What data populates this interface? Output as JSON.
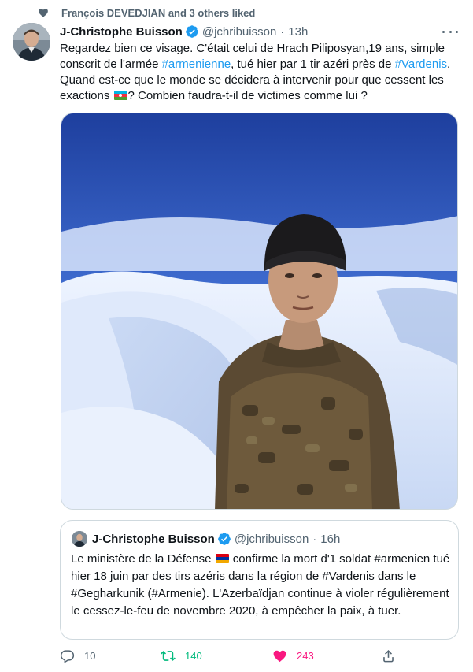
{
  "social_context": {
    "text": "François DEVEDJIAN and 3 others liked"
  },
  "tweet": {
    "author_name": "J-Christophe Buisson",
    "handle": "@jchribuisson",
    "separator": "·",
    "time": "13h",
    "text": {
      "part1": "Regardez bien ce visage. C'était celui de Hrach Piliposyan,19 ans, simple conscrit de l'armée ",
      "hashtag1": "#armenienne",
      "part2": ", tué hier par 1 tir azéri près de ",
      "hashtag2": "#Vardenis",
      "part3": ". Quand est-ce que le monde se décidera à intervenir pour que cessent les exactions ",
      "part4": "? Combien faudra-t-il de victimes comme lui ?"
    }
  },
  "quoted_tweet": {
    "author_name": "J-Christophe Buisson",
    "handle": "@jchribuisson",
    "separator": "·",
    "time": "16h",
    "text": {
      "part1": "Le ministère de la Défense ",
      "part2": " confirme la mort d'1 soldat #armenien tué hier 18 juin par des tirs azéris dans la région de #Vardenis dans le #Gegharkunik (#Armenie). L'Azerbaïdjan continue à violer régulièrement le cessez-le-feu de novembre 2020, à empêcher la paix, à tuer."
    }
  },
  "actions": {
    "replies": "10",
    "retweets": "140",
    "likes": "243"
  },
  "colors": {
    "accent": "#1d9bf0",
    "retweet": "#00ba7c",
    "like": "#f91880",
    "secondary_text": "#536471"
  }
}
